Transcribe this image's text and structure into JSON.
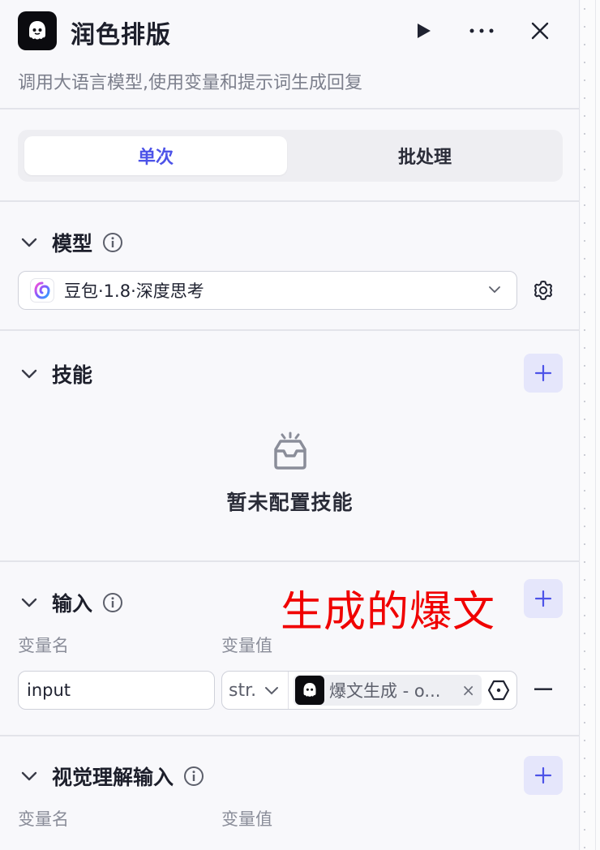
{
  "header": {
    "title": "润色排版",
    "subtitle": "调用大语言模型,使用变量和提示词生成回复",
    "icons": [
      "ghost-logo",
      "play-icon",
      "more-icon",
      "close-icon"
    ]
  },
  "tabs": {
    "single": "单次",
    "batch": "批处理"
  },
  "model": {
    "section_title": "模型",
    "selected": "豆包·1.8·深度思考"
  },
  "skills": {
    "section_title": "技能",
    "empty_text": "暂未配置技能"
  },
  "input": {
    "section_title": "输入",
    "col_name": "变量名",
    "col_value": "变量值",
    "rows": [
      {
        "name": "input",
        "type": "str.",
        "ref": "爆文生成 - o..."
      }
    ]
  },
  "annotation": "生成的爆文",
  "vision": {
    "section_title": "视觉理解输入",
    "col_name": "变量名",
    "col_value": "变量值"
  },
  "colors": {
    "accent": "#4d53e8",
    "annotation": "#f00000",
    "add_bg": "#e5e6fb"
  }
}
